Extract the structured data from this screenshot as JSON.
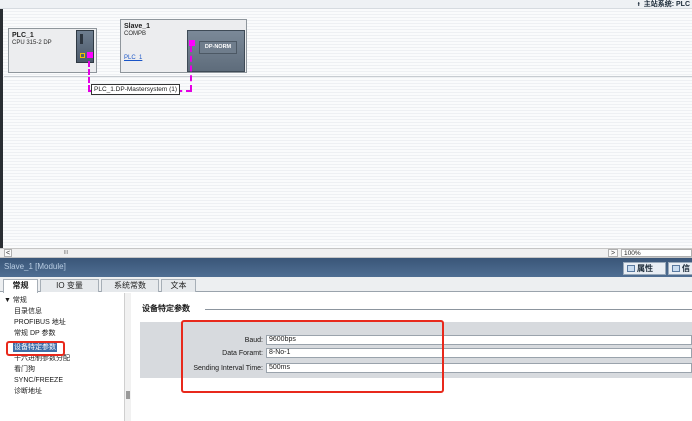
{
  "header": {
    "master_system": "主站系统: PLC"
  },
  "network": {
    "plc": {
      "name": "PLC_1",
      "type": "CPU 315-2 DP"
    },
    "slave": {
      "name": "Slave_1",
      "type": "COMPB",
      "link": "PLC_1",
      "module_label": "DP-NORM"
    },
    "bus_label": "PLC_1.DP-Mastersystem (1)"
  },
  "scrollbar": {
    "left_arrow": "<",
    "thumb": "III",
    "right_arrow": ">",
    "zoom": "100%"
  },
  "inspector": {
    "title": "Slave_1 [Module]",
    "tabs_right": [
      "属性",
      "信"
    ],
    "tabs": [
      "常规",
      "IO 变量",
      "系统常数",
      "文本"
    ],
    "tree": [
      "▼ 常规",
      "目录信息",
      "PROFIBUS 地址",
      "常规 DP 参数",
      "设备特定参数",
      "十六进制参数分配",
      "看门狗",
      "SYNC/FREEZE",
      "诊断地址"
    ],
    "section_title": "设备特定参数",
    "params": [
      {
        "label": "Baud:",
        "value": "9600bps"
      },
      {
        "label": "Data Foramt:",
        "value": "8-No-1"
      },
      {
        "label": "Sending Interval Time:",
        "value": "500ms"
      }
    ]
  },
  "colors": {
    "highlight_box": "#e8291c",
    "profibus_line": "#e400e4",
    "selected_tree": "#3f6ea7",
    "inspector_header": "#3a5678"
  },
  "icons": [
    "pin-icon",
    "properties-icon",
    "info-icon"
  ]
}
